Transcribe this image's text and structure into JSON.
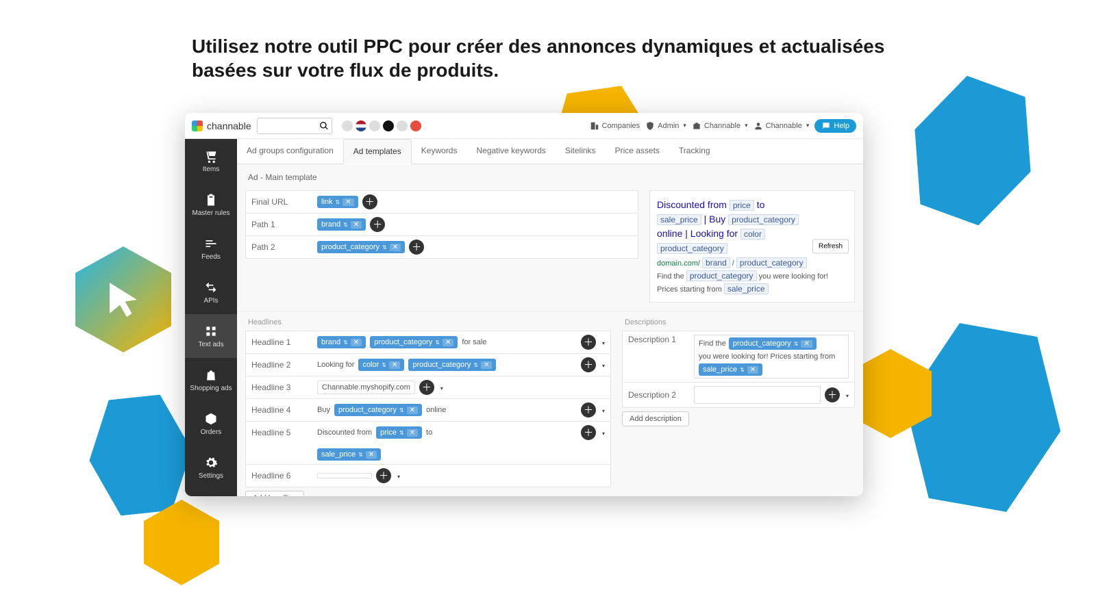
{
  "hero": "Utilisez notre outil PPC pour créer des annonces dynamiques et actualisées basées sur votre flux de produits.",
  "brand": "channable",
  "toplinks": {
    "companies": "Companies",
    "admin": "Admin",
    "channable1": "Channable",
    "channable2": "Channable",
    "help": "Help"
  },
  "sidebar": [
    {
      "label": "Items"
    },
    {
      "label": "Master rules"
    },
    {
      "label": "Feeds"
    },
    {
      "label": "APIs"
    },
    {
      "label": "Text ads"
    },
    {
      "label": "Shopping ads"
    },
    {
      "label": "Orders"
    },
    {
      "label": "Settings"
    }
  ],
  "tabs": [
    "Ad groups configuration",
    "Ad templates",
    "Keywords",
    "Negative keywords",
    "Sitelinks",
    "Price assets",
    "Tracking"
  ],
  "ad_title": "Ad - Main template",
  "urlfields": {
    "final_label": "Final URL",
    "final_token": "link",
    "path1_label": "Path 1",
    "path1_token": "brand",
    "path2_label": "Path 2",
    "path2_token": "product_category"
  },
  "headlines_label": "Headlines",
  "descriptions_label": "Descriptions",
  "headlines": {
    "h1_label": "Headline 1",
    "h1_t1": "brand",
    "h1_t2": "product_category",
    "h1_text": "for sale",
    "h2_label": "Headline 2",
    "h2_pre": "Looking for",
    "h2_t1": "color",
    "h2_t2": "product_category",
    "h3_label": "Headline 3",
    "h3_text": "Channable.myshopify.com",
    "h4_label": "Headline 4",
    "h4_pre": "Buy",
    "h4_t": "product_category",
    "h4_post": "online",
    "h5_label": "Headline 5",
    "h5_pre": "Discounted from",
    "h5_t1": "price",
    "h5_mid": "to",
    "h5_t2": "sale_price",
    "h6_label": "Headline 6"
  },
  "add_headline": "Add headline",
  "desc": {
    "d1_label": "Description 1",
    "d1_pre": "Find the",
    "d1_t1": "product_category",
    "d1_mid": "you were looking for! Prices starting from",
    "d1_t2": "sale_price",
    "d2_label": "Description 2"
  },
  "add_description": "Add description",
  "preview": {
    "refresh": "Refresh",
    "discounted": "Discounted from",
    "to": "to",
    "buy": "| Buy",
    "online": "online | Looking for",
    "price": "price",
    "sale_price": "sale_price",
    "product_category": "product_category",
    "color": "color",
    "brand": "brand",
    "domain": "domain.com/",
    "findthe": "Find the",
    "ywlf": "you were looking for!",
    "pstart": "Prices starting from"
  }
}
